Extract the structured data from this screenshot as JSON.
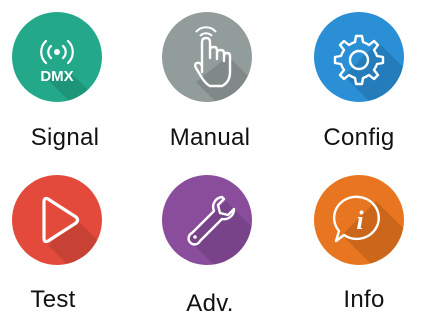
{
  "tiles": [
    {
      "label": "Signal",
      "icon": "dmx-signal-icon",
      "color": "#23a98a",
      "sub": "DMX"
    },
    {
      "label": "Manual",
      "icon": "hand-pointer-icon",
      "color": "#929c9b"
    },
    {
      "label": "Config",
      "icon": "gear-icon",
      "color": "#2a8fd4"
    },
    {
      "label": "Test",
      "icon": "play-icon",
      "color": "#e34a3c"
    },
    {
      "label": "Adv.",
      "icon": "wrench-icon",
      "color": "#8a4d9c"
    },
    {
      "label": "Info",
      "icon": "info-chat-icon",
      "color": "#e8751f",
      "glyph": "i"
    }
  ]
}
